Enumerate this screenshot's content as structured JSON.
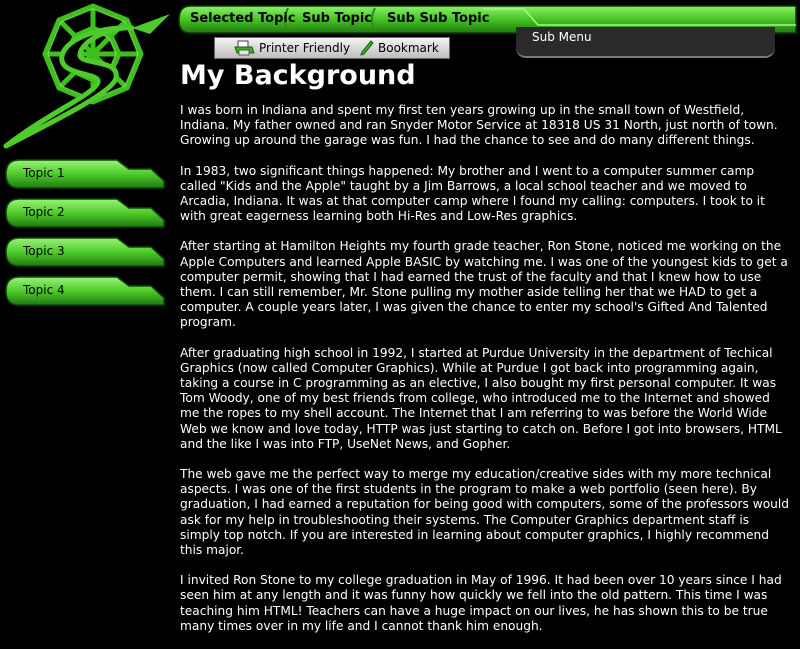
{
  "top_nav": {
    "selected_topic": "Selected Topic",
    "sub_topic": "Sub Topic",
    "sub_sub_topic": "Sub Sub Topic"
  },
  "toolbar": {
    "printer_friendly": "Printer Friendly",
    "bookmark": "Bookmark"
  },
  "submenu": {
    "label": "Sub Menu"
  },
  "sidebar": {
    "items": [
      {
        "label": "Topic 1"
      },
      {
        "label": "Topic 2"
      },
      {
        "label": "Topic 3"
      },
      {
        "label": "Topic 4"
      }
    ]
  },
  "page": {
    "title": "My Background",
    "paragraphs": [
      "I was born in Indiana and spent my first ten years growing up in the small town of Westfield, Indiana. My father owned and ran Snyder Motor Service at 18318 US 31 North, just north of town. Growing up around the garage was fun. I had the chance to see and do many different things.",
      "In 1983, two significant things happened: My brother and I went to a computer summer camp called \"Kids and the Apple\" taught by a Jim Barrows, a local school teacher and we moved to Arcadia, Indiana. It was at that computer camp where I found my calling: computers. I took to it with great eagerness learning both Hi-Res and Low-Res graphics.",
      "After starting at Hamilton Heights my fourth grade teacher, Ron Stone, noticed me working on the Apple Computers and learned Apple BASIC by watching me. I was one of the youngest kids to get a computer permit, showing that I had earned the trust of the faculty and that I knew how to use them. I can still remember, Mr. Stone pulling my mother aside telling her that we HAD to get a computer. A couple years later, I was given the chance to enter my school's Gifted And Talented program.",
      "After graduating high school in 1992, I started at Purdue University in the department of Techical Graphics (now called Computer Graphics). While at Purdue I got back into programming again, taking a course in C programming as an elective, I also bought my first personal computer. It was Tom Woody, one of my best friends from college, who introduced me to the Internet and showed me the ropes to my shell account. The Internet that I am referring to was before the World Wide Web we know and love today, HTTP was just starting to catch on. Before I got into browsers, HTML and the like I was into FTP, UseNet News, and Gopher.",
      "The web gave me the perfect way to merge my education/creative sides with my more technical aspects. I was one of the first students in the program to make a web portfolio (seen here). By graduation, I had earned a reputation for being good with computers, some of the professors would ask for my help in troubleshooting their systems. The Computer Graphics department staff is simply top notch. If you are interested in learning about computer graphics, I highly recommend this major.",
      "I invited Ron Stone to my college graduation in May of 1996. It had been over 10 years since I had seen him at any length and it was funny how quickly we fell into the old pattern. This time I was teaching him HTML! Teachers can have a huge impact on our lives, he has shown this to be true many times over in my life and I cannot thank him enough."
    ]
  },
  "colors": {
    "accent_green": "#4ecb2a",
    "dark_green": "#1f6f10",
    "background": "#000000"
  },
  "icons": {
    "logo": "green-web-s-logo",
    "printer": "printer-icon",
    "bookmark": "pen-icon"
  }
}
